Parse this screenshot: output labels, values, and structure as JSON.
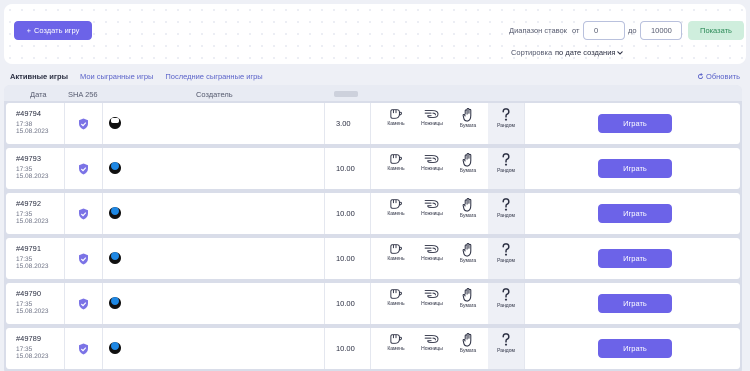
{
  "toolbar": {
    "create_label": "Создать игру",
    "range_label": "Диапазон ставок",
    "from_label": "от",
    "from_value": "0",
    "to_label": "до",
    "to_value": "10000",
    "show_label": "Показать",
    "sort_label": "Сортировка",
    "sort_value": "по дате создания"
  },
  "tabs": [
    "Активные игры",
    "Мои сыгранные игры",
    "Последние сыгранные игры"
  ],
  "refresh_label": "Обновить",
  "columns": {
    "date": "Дата",
    "sha": "SHA 256",
    "creator": "Создатель"
  },
  "choices": {
    "rock": "Камень",
    "scissors": "Ножницы",
    "paper": "Бумага",
    "random": "Рандом"
  },
  "play_label": "Играть",
  "rows": [
    {
      "id": "#49794",
      "time": "17:38",
      "date": "15.08.2023",
      "amount": "3.00",
      "avatar": "white"
    },
    {
      "id": "#49793",
      "time": "17:35",
      "date": "15.08.2023",
      "amount": "10.00",
      "avatar": "blue"
    },
    {
      "id": "#49792",
      "time": "17:35",
      "date": "15.08.2023",
      "amount": "10.00",
      "avatar": "blue"
    },
    {
      "id": "#49791",
      "time": "17:35",
      "date": "15.08.2023",
      "amount": "10.00",
      "avatar": "blue"
    },
    {
      "id": "#49790",
      "time": "17:35",
      "date": "15.08.2023",
      "amount": "10.00",
      "avatar": "blue"
    },
    {
      "id": "#49789",
      "time": "17:35",
      "date": "15.08.2023",
      "amount": "10.00",
      "avatar": "blue"
    }
  ]
}
